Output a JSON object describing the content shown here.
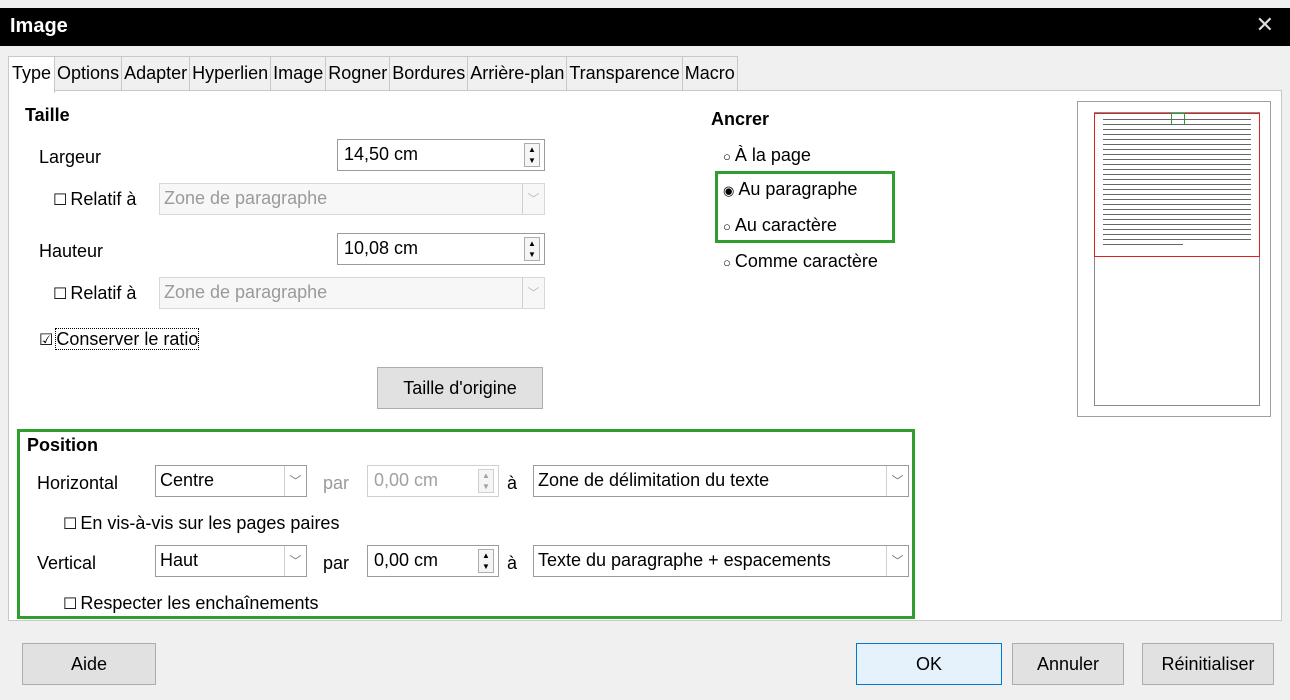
{
  "window": {
    "title": "Image",
    "close_glyph": "✕"
  },
  "tabs": [
    "Type",
    "Options",
    "Adapter",
    "Hyperlien",
    "Image",
    "Rogner",
    "Bordures",
    "Arrière-plan",
    "Transparence",
    "Macro"
  ],
  "taille": {
    "heading": "Taille",
    "largeur_label": "Largeur",
    "largeur_value": "14,50 cm",
    "relatif_label": "Relatif à",
    "relatif_value": "Zone de paragraphe",
    "hauteur_label": "Hauteur",
    "hauteur_value": "10,08 cm",
    "relatif2_label": "Relatif à",
    "relatif2_value": "Zone de paragraphe",
    "ratio_label": "Conserver le ratio",
    "origine_button": "Taille d'origine"
  },
  "ancrer": {
    "heading": "Ancrer",
    "options": [
      "À la page",
      "Au paragraphe",
      "Au caractère",
      "Comme caractère"
    ],
    "selected": "Au paragraphe"
  },
  "position": {
    "heading": "Position",
    "horizontal_label": "Horizontal",
    "horizontal_value": "Centre",
    "par_label": "par",
    "horizontal_offset": "0,00 cm",
    "a_label": "à",
    "horizontal_ref": "Zone de délimitation du texte",
    "vis_a_vis_label": "En vis-à-vis sur les pages paires",
    "vertical_label": "Vertical",
    "vertical_value": "Haut",
    "vertical_offset": "0,00 cm",
    "vertical_ref": "Texte du paragraphe + espacements",
    "respecter_label": "Respecter les enchaînements"
  },
  "footer": {
    "help": "Aide",
    "ok": "OK",
    "cancel": "Annuler",
    "reset": "Réinitialiser"
  }
}
